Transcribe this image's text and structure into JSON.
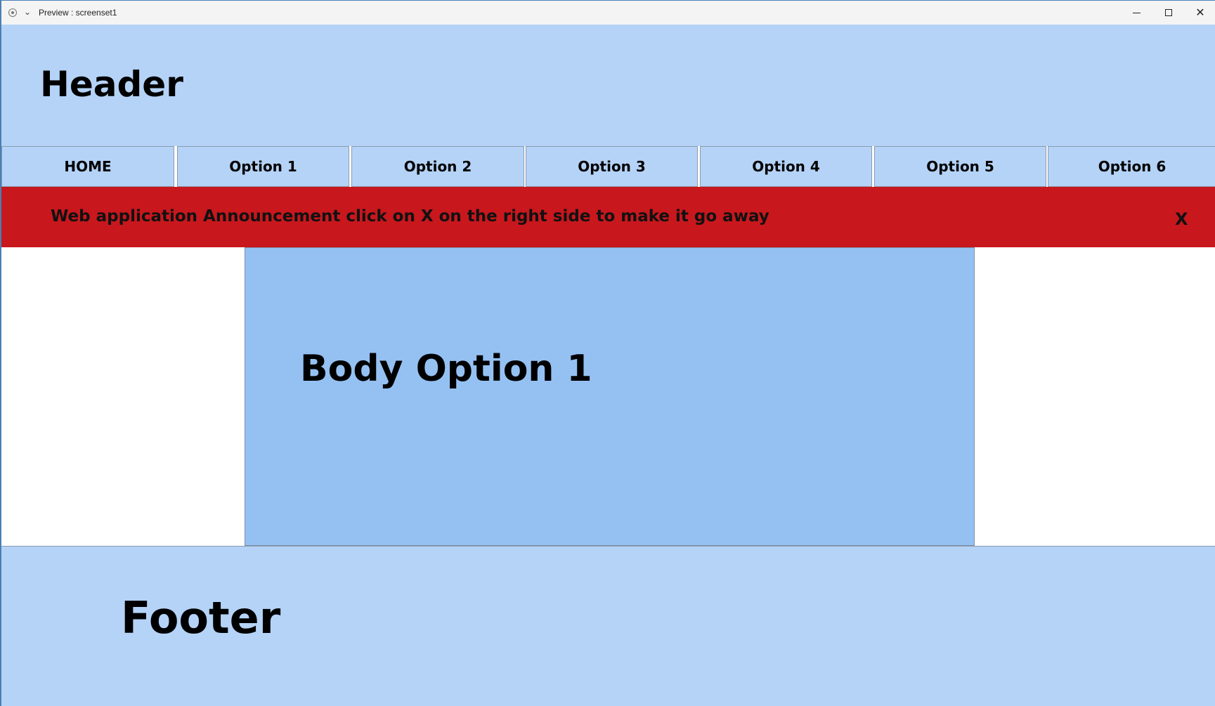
{
  "window": {
    "title": "Preview : screenset1"
  },
  "icons": {
    "record": "record-icon",
    "chevron": "chevron-down-icon",
    "minimize": "minimize-icon",
    "maximize": "maximize-icon",
    "close": "close-icon"
  },
  "header": {
    "title": "Header"
  },
  "nav": {
    "items": [
      {
        "label": "HOME"
      },
      {
        "label": "Option 1"
      },
      {
        "label": "Option 2"
      },
      {
        "label": "Option 3"
      },
      {
        "label": "Option 4"
      },
      {
        "label": "Option 5"
      },
      {
        "label": "Option 6"
      }
    ]
  },
  "announcement": {
    "text": "Web application Announcement  click on X on the right side to make it go away",
    "close_label": "X"
  },
  "body": {
    "title": "Body Option 1"
  },
  "footer": {
    "title": "Footer"
  },
  "colors": {
    "light_blue": "#b5d3f6",
    "panel_blue": "#95c0f2",
    "announcement_red": "#c8181d"
  }
}
